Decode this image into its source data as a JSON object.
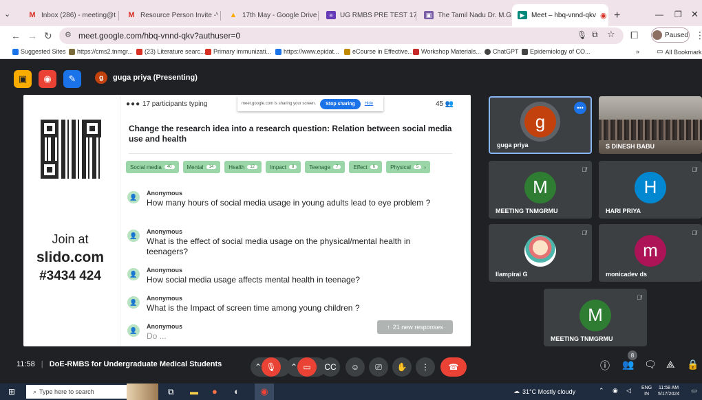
{
  "browser": {
    "tabs": [
      {
        "label": "Inbox (286) - meeting@tn",
        "icon": "gmail-icon",
        "color": "#d93025"
      },
      {
        "label": "Resource Person Invite -Vi",
        "icon": "gmail-icon",
        "color": "#d93025"
      },
      {
        "label": "17th May - Google Drive",
        "icon": "drive-icon",
        "color": "#1a73e8"
      },
      {
        "label": "UG RMBS PRE TEST 17/05/",
        "icon": "forms-icon",
        "color": "#673ab7"
      },
      {
        "label": "The Tamil Nadu Dr. M.G.R.",
        "icon": "site-icon",
        "color": "#7a5ea6"
      },
      {
        "label": "Meet – hbq-vnnd-qkv",
        "icon": "meet-icon",
        "color": "#00897b"
      }
    ],
    "url": "meet.google.com/hbq-vnnd-qkv?authuser=0",
    "paused_label": "Paused",
    "bookmarks": [
      {
        "label": "Suggested Sites",
        "color": "#1a73e8"
      },
      {
        "label": "https://cms2.tnmgr...",
        "color": "#7b6b3b"
      },
      {
        "label": "(23) Literature searc...",
        "color": "#d93025"
      },
      {
        "label": "Primary immunizati...",
        "color": "#d93025"
      },
      {
        "label": "https://www.epidat...",
        "color": "#1a73e8"
      },
      {
        "label": "eCourse in Effective...",
        "color": "#c08a00"
      },
      {
        "label": "Workshop Materials...",
        "color": "#c62828"
      },
      {
        "label": "ChatGPT",
        "color": "#444"
      },
      {
        "label": "Epidemiology of CO...",
        "color": "#444"
      }
    ],
    "all_bookmarks": "All Bookmarks"
  },
  "meet": {
    "presenter_initial": "g",
    "presenter_label": "guga priya (Presenting)",
    "slido": {
      "join_at": "Join at",
      "site": "slido.com",
      "code": "#3434 424",
      "participants_typing": "17 participants typing",
      "count": "45",
      "share_banner": "meet.google.com is sharing your screen.",
      "stop_sharing": "Stop sharing",
      "hide": "Hide",
      "question": "Change the research idea into a research question: Relation between social media use and health",
      "chips": [
        {
          "label": "Social media",
          "n": "40"
        },
        {
          "label": "Mental",
          "n": "14"
        },
        {
          "label": "Health",
          "n": "12"
        },
        {
          "label": "Impact",
          "n": "8"
        },
        {
          "label": "Teenage",
          "n": "7"
        },
        {
          "label": "Effect",
          "n": "6"
        },
        {
          "label": "Physical",
          "n": "5"
        }
      ],
      "responses": [
        {
          "name": "Anonymous",
          "text": "How many hours of social media usage in young adults lead to eye problem ?"
        },
        {
          "name": "Anonymous",
          "text": "What is the effect of social media usage on the physical/mental health in teenagers?"
        },
        {
          "name": "Anonymous",
          "text": "How social media usage affects mental health in teenage?"
        },
        {
          "name": "Anonymous",
          "text": "What is the Impact of screen time among young children ?"
        },
        {
          "name": "Anonymous",
          "text": "Do ..."
        }
      ],
      "new_responses": "21 new responses"
    },
    "tiles": [
      {
        "name": "guga priya",
        "initial": "g",
        "color": "#c2410c"
      },
      {
        "name": "S DINESH BABU",
        "initial": "",
        "color": ""
      },
      {
        "name": "MEETING TNMGRMU",
        "initial": "M",
        "color": "#2e7d32"
      },
      {
        "name": "HARI PRIYA",
        "initial": "H",
        "color": "#0288d1"
      },
      {
        "name": "Ilampirai G",
        "initial": "",
        "color": ""
      },
      {
        "name": "monicadev ds",
        "initial": "m",
        "color": "#ad1457"
      },
      {
        "name": "MEETING TNMGRMU",
        "initial": "M",
        "color": "#2e7d32"
      }
    ],
    "time": "11:58",
    "meeting_title": "DoE-RMBS for Undergraduate Medical Students",
    "people_badge": "8"
  },
  "taskbar": {
    "search_placeholder": "Type here to search",
    "weather": "31°C  Mostly cloudy",
    "lang": "ENG",
    "region": "IN",
    "time": "11:58 AM",
    "date": "5/17/2024"
  }
}
